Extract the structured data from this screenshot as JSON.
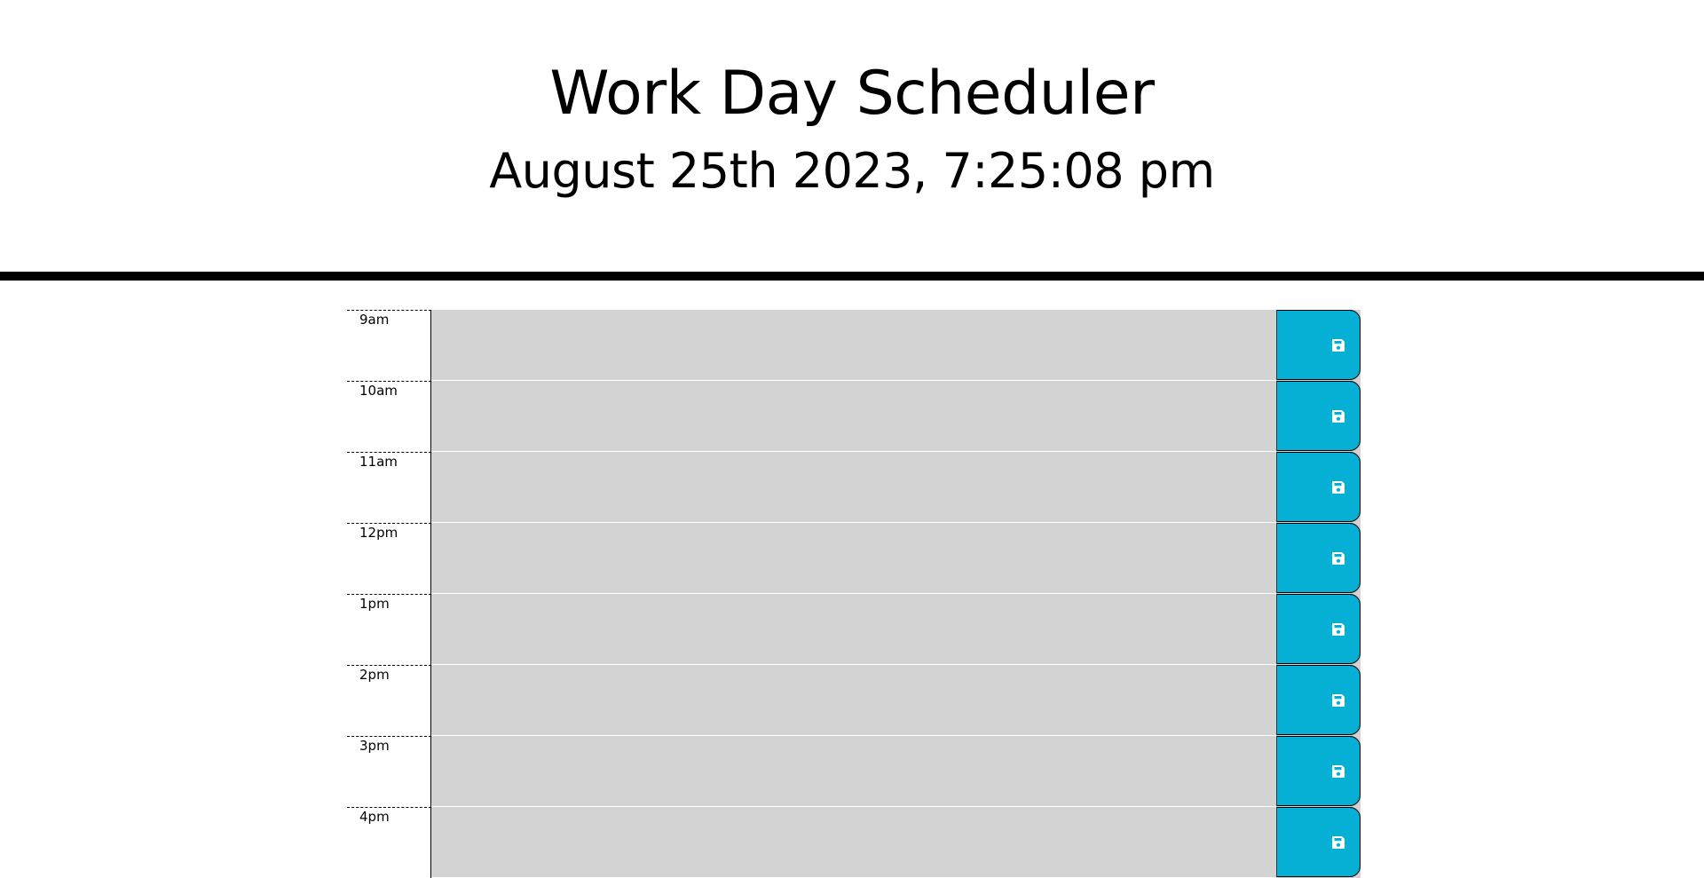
{
  "header": {
    "title": "Work Day Scheduler",
    "current_datetime": "August 25th 2023, 7:25:08 pm"
  },
  "time_blocks": [
    {
      "hour": "9am",
      "text": "",
      "save_icon": "floppy-disk-icon"
    },
    {
      "hour": "10am",
      "text": "",
      "save_icon": "floppy-disk-icon"
    },
    {
      "hour": "11am",
      "text": "",
      "save_icon": "floppy-disk-icon"
    },
    {
      "hour": "12pm",
      "text": "",
      "save_icon": "floppy-disk-icon"
    },
    {
      "hour": "1pm",
      "text": "",
      "save_icon": "floppy-disk-icon"
    },
    {
      "hour": "2pm",
      "text": "",
      "save_icon": "floppy-disk-icon"
    },
    {
      "hour": "3pm",
      "text": "",
      "save_icon": "floppy-disk-icon"
    },
    {
      "hour": "4pm",
      "text": "",
      "save_icon": "floppy-disk-icon"
    }
  ],
  "colors": {
    "past_block": "#d3d3d3",
    "save_button": "#06b0d5",
    "divider": "#000000"
  }
}
